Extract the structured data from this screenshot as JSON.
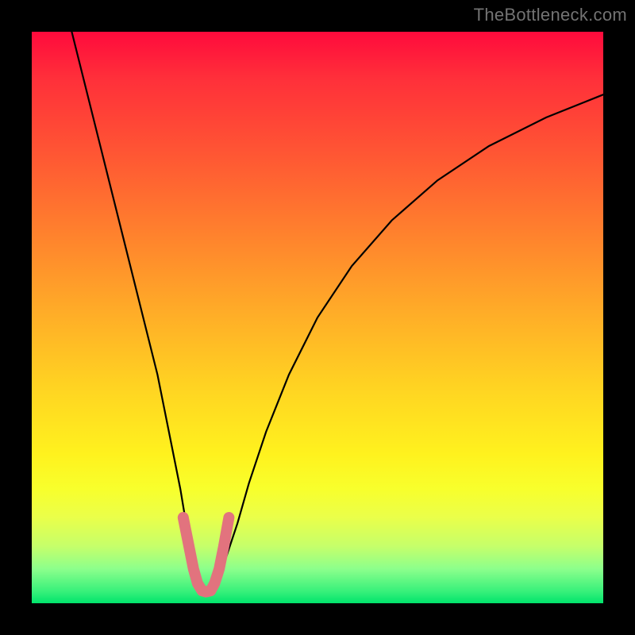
{
  "watermark": "TheBottleneck.com",
  "chart_data": {
    "type": "line",
    "title": "",
    "xlabel": "",
    "ylabel": "",
    "xlim": [
      0,
      100
    ],
    "ylim": [
      0,
      100
    ],
    "grid": false,
    "legend": false,
    "annotations": [],
    "series": [
      {
        "name": "bottleneck-curve",
        "color": "#000000",
        "x": [
          7,
          10,
          13,
          16,
          19,
          22,
          24,
          26,
          27,
          28,
          29,
          30,
          31,
          32,
          33,
          34,
          36,
          38,
          41,
          45,
          50,
          56,
          63,
          71,
          80,
          90,
          100
        ],
        "values": [
          100,
          88,
          76,
          64,
          52,
          40,
          30,
          20,
          14,
          9,
          5,
          3,
          2,
          3,
          5,
          8,
          14,
          21,
          30,
          40,
          50,
          59,
          67,
          74,
          80,
          85,
          89
        ]
      },
      {
        "name": "optimal-highlight",
        "color": "#e2737e",
        "x": [
          26.5,
          27.5,
          28.3,
          29.0,
          29.8,
          30.5,
          31.3,
          32.0,
          32.8,
          33.6,
          34.5
        ],
        "values": [
          15.0,
          10.0,
          6.0,
          3.5,
          2.2,
          2.0,
          2.2,
          3.5,
          6.0,
          10.0,
          15.0
        ]
      }
    ],
    "background_gradient": {
      "top": "#ff0a3c",
      "mid": "#fff21e",
      "bottom": "#00e46c"
    }
  }
}
